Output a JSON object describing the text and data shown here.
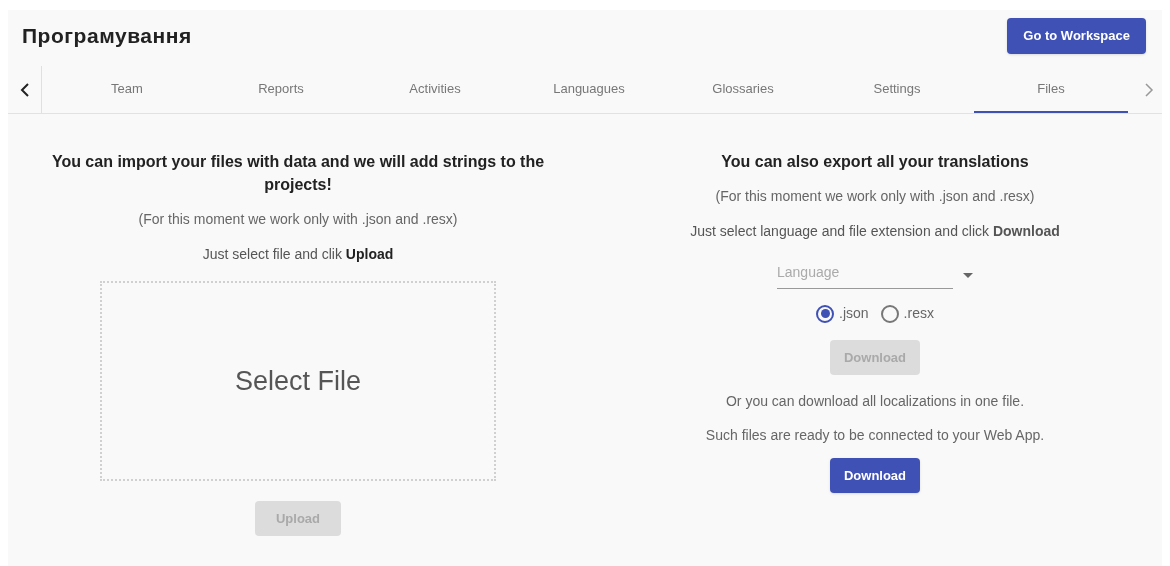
{
  "header": {
    "title": "Програмування",
    "action_button": "Go to Workspace"
  },
  "tabs": [
    {
      "label": "Team",
      "selected": false
    },
    {
      "label": "Reports",
      "selected": false
    },
    {
      "label": "Activities",
      "selected": false
    },
    {
      "label": "Languagues",
      "selected": false
    },
    {
      "label": "Glossaries",
      "selected": false
    },
    {
      "label": "Settings",
      "selected": false
    },
    {
      "label": "Files",
      "selected": true
    }
  ],
  "import": {
    "heading": "You can import your files with data and we will add strings to the projects!",
    "note": "(For this moment we work only with .json and .resx)",
    "instruction": "Just select file and clik **Upload**",
    "dropzone": "Select File",
    "button": {
      "label": "Upload",
      "disabled": true
    }
  },
  "export": {
    "heading": "You can also export all your translations",
    "note": "(For this moment we work only with .json and .resx)",
    "instruction": "Just select language and file extension and click **Download**",
    "language_select": {
      "placeholder": "Language"
    },
    "formats": [
      {
        "label": ".json",
        "selected": true
      },
      {
        "label": ".resx",
        "selected": false
      }
    ],
    "button": {
      "label": "Download",
      "disabled": true
    },
    "all_note": "Or you can download all localizations in one file.",
    "all_note_2": "Such files are ready to be connected to your Web App.",
    "all_button": {
      "label": "Download",
      "disabled": false
    }
  }
}
